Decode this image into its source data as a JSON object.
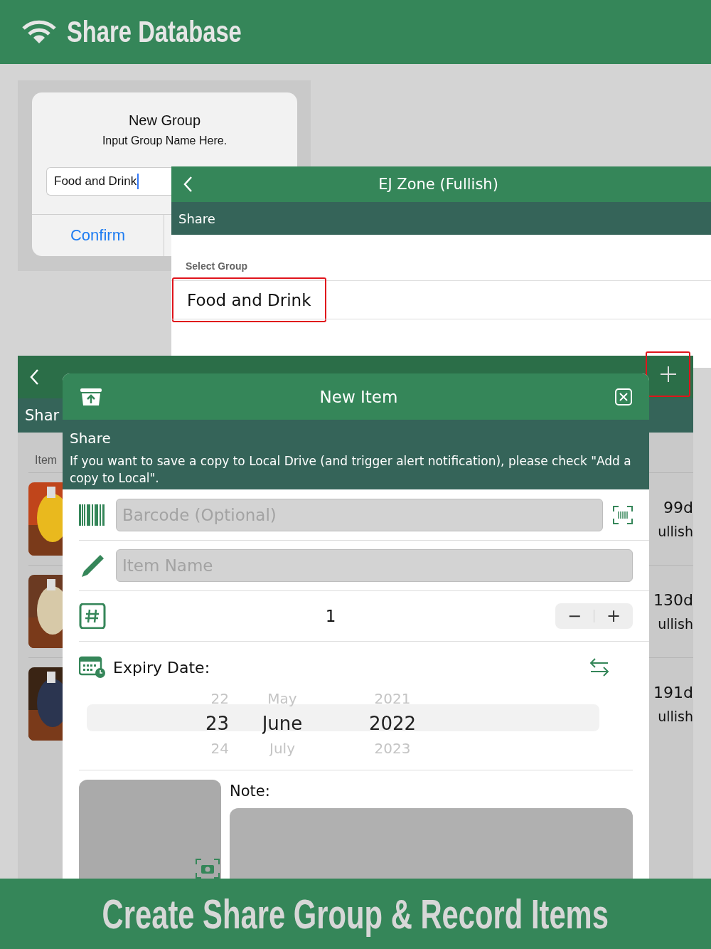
{
  "header": {
    "title": "Share Database"
  },
  "new_group_dialog": {
    "title": "New Group",
    "message": "Input Group Name Here.",
    "field_value": "Food and Drink",
    "confirm": "Confirm"
  },
  "zone_screen": {
    "title": "EJ Zone (Fullish)",
    "section": "Share",
    "select_label": "Select Group",
    "group": "Food and Drink",
    "highlighted": true
  },
  "list_screen": {
    "section": "Shar",
    "column_label": "Item",
    "add_highlighted": true,
    "rows": [
      {
        "kind": "picture",
        "days": "99d",
        "status": "ullish"
      },
      {
        "kind": "picture",
        "days": "130d",
        "status": "ullish"
      },
      {
        "kind": "picture",
        "days": "191d",
        "status": "ullish"
      }
    ]
  },
  "new_item": {
    "title": "New Item",
    "section": "Share",
    "notice": "If you want to save a copy to Local Drive (and trigger alert notification), please check \"Add a copy to Local\".",
    "barcode_placeholder": "Barcode (Optional)",
    "name_placeholder": "Item Name",
    "quantity": "1",
    "decrement": "−",
    "increment": "+",
    "expiry_label": "Expiry Date:",
    "picker": [
      {
        "items": [
          {
            "label": "22",
            "selected": false
          },
          {
            "label": "23",
            "selected": true
          },
          {
            "label": "24",
            "selected": false
          }
        ]
      },
      {
        "items": [
          {
            "label": "May",
            "selected": false
          },
          {
            "label": "June",
            "selected": true
          },
          {
            "label": "July",
            "selected": false
          }
        ]
      },
      {
        "items": [
          {
            "label": "2021",
            "selected": false
          },
          {
            "label": "2022",
            "selected": true
          },
          {
            "label": "2023",
            "selected": false
          }
        ]
      }
    ],
    "note_label": "Note:"
  },
  "footer": {
    "caption": "Create Share Group & Record Items"
  }
}
